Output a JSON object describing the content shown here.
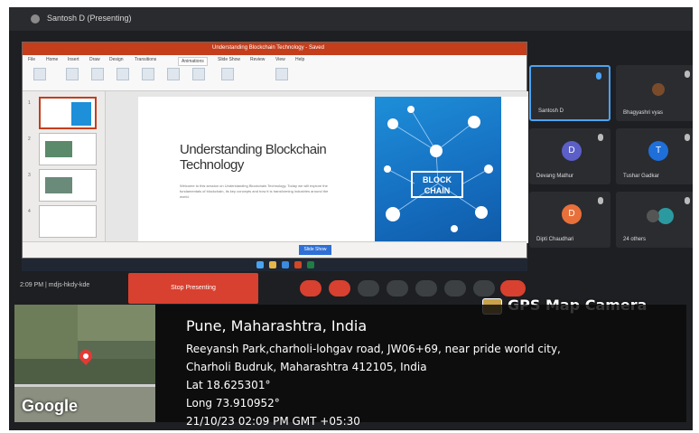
{
  "meet": {
    "title": "Santosh D (Presenting)",
    "time": "2:09 PM",
    "meeting_code": "mdjs-hkdy-kde",
    "stop_presenting_label": "Stop Presenting"
  },
  "ppt": {
    "window_title": "Understanding Blockchain Technology - Saved",
    "ribbon_tabs": [
      "File",
      "Home",
      "Insert",
      "Draw",
      "Design",
      "Transitions",
      "Animations",
      "Slide Show",
      "Review",
      "View",
      "Help"
    ],
    "slide_title": "Understanding Blockchain Technology",
    "slide_body": "Welcome to this session on Understanding Blockchain Technology. Today we will explore the fundamentals of blockchain, its key concepts and how it is transforming industries around the world.",
    "blockchain_graphic_text": "BLOCK CHAIN",
    "status_button": "Slide Show"
  },
  "participants": [
    {
      "name": "Santosh D",
      "initial": "",
      "color": "#2b2c30"
    },
    {
      "name": "Bhagyashri vyas",
      "initial": "",
      "color": "#7a4b2a"
    },
    {
      "name": "Devang Mathur",
      "initial": "D",
      "color": "#5b5fc7"
    },
    {
      "name": "Tushar Gadkar",
      "initial": "T",
      "color": "#1e6fd9"
    },
    {
      "name": "Dipti Chaudhari",
      "initial": "D",
      "color": "#e8703a"
    },
    {
      "name": "24 others",
      "initial": "",
      "color": "#2b9aa0"
    }
  ],
  "gps": {
    "brand": "GPS Map Camera",
    "city": "Pune, Maharashtra, India",
    "address_line1": "Reeyansh Park,charholi-lohgav road, JW06+69, near pride world city,",
    "address_line2": "Charholi Budruk, Maharashtra 412105, India",
    "lat": "Lat 18.625301°",
    "long": "Long 73.910952°",
    "datetime": "21/10/23 02:09 PM GMT +05:30",
    "map_logo": "Google"
  },
  "colors": {
    "ppt_accent": "#c43e1c",
    "meet_bg": "#1e1f22",
    "end_call": "#d8402f",
    "map_pin": "#e53935"
  }
}
